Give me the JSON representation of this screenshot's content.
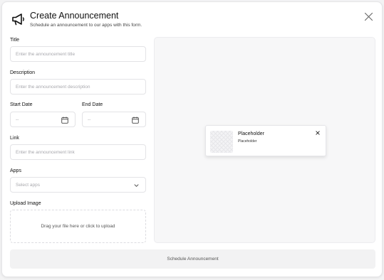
{
  "header": {
    "title": "Create Announcement",
    "subtitle": "Schedule an announcement to our apps with this form.",
    "icon": "megaphone-icon",
    "close_icon": "close-icon"
  },
  "form": {
    "title_label": "Title",
    "title_placeholder": "Enter the announcement title",
    "description_label": "Description",
    "description_placeholder": "Enter the announcement description",
    "start_date_label": "Start Date",
    "start_date_value": "--",
    "end_date_label": "End Date",
    "end_date_value": "--",
    "link_label": "Link",
    "link_placeholder": "Enter the announcement link",
    "apps_label": "Apps",
    "apps_placeholder": "Select apps",
    "upload_label": "Upload Image",
    "upload_text": "Drag your file here or click to upload"
  },
  "preview": {
    "toast_title": "Placeholder",
    "toast_body": "Placeholder"
  },
  "submit_label": "Schedule Announcement",
  "colors": {
    "border": "#e3e3e6",
    "preview_bg": "#f7f7f8",
    "button_bg": "#f2f2f3"
  }
}
